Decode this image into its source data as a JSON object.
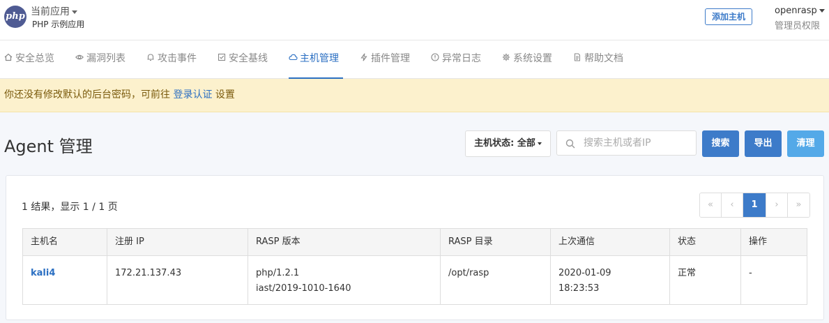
{
  "header": {
    "logo_text": "php",
    "app_switch_label": "当前应用",
    "app_name": "PHP 示例应用",
    "add_host_label": "添加主机",
    "username": "openrasp",
    "role": "管理员权限"
  },
  "nav": {
    "items": [
      {
        "label": "安全总览",
        "icon": "home-icon"
      },
      {
        "label": "漏洞列表",
        "icon": "eye-icon"
      },
      {
        "label": "攻击事件",
        "icon": "bell-icon"
      },
      {
        "label": "安全基线",
        "icon": "check-square-icon"
      },
      {
        "label": "主机管理",
        "icon": "cloud-icon",
        "active": true
      },
      {
        "label": "插件管理",
        "icon": "lightning-icon"
      },
      {
        "label": "异常日志",
        "icon": "warning-circle-icon"
      },
      {
        "label": "系统设置",
        "icon": "gear-icon"
      },
      {
        "label": "帮助文档",
        "icon": "document-icon"
      }
    ]
  },
  "alert": {
    "text_before": "你还没有修改默认的后台密码，可前往 ",
    "link_text": "登录认证",
    "text_after": " 设置"
  },
  "page": {
    "title": "Agent 管理",
    "status_filter": "主机状态: 全部",
    "search_placeholder": "搜索主机或者IP",
    "search_button": "搜索",
    "export_button": "导出",
    "clear_button": "清理"
  },
  "results": {
    "summary": "1 结果，显示 1 / 1 页",
    "pager": {
      "first": "«",
      "prev": "‹",
      "current": "1",
      "next": "›",
      "last": "»"
    }
  },
  "table": {
    "headers": [
      "主机名",
      "注册 IP",
      "RASP 版本",
      "RASP 目录",
      "上次通信",
      "状态",
      "操作"
    ],
    "rows": [
      {
        "hostname": "kali4",
        "ip": "172.21.137.43",
        "version_line1": "php/1.2.1",
        "version_line2": "iast/2019-1010-1640",
        "dir": "/opt/rasp",
        "last_seen_date": "2020-01-09",
        "last_seen_time": "18:23:53",
        "status": "正常",
        "action": "-"
      }
    ]
  },
  "colors": {
    "primary": "#3d7bc9",
    "clear_button": "#54a9e8",
    "alert_bg": "#fcf1cd",
    "active_nav": "#2b6fc2"
  }
}
